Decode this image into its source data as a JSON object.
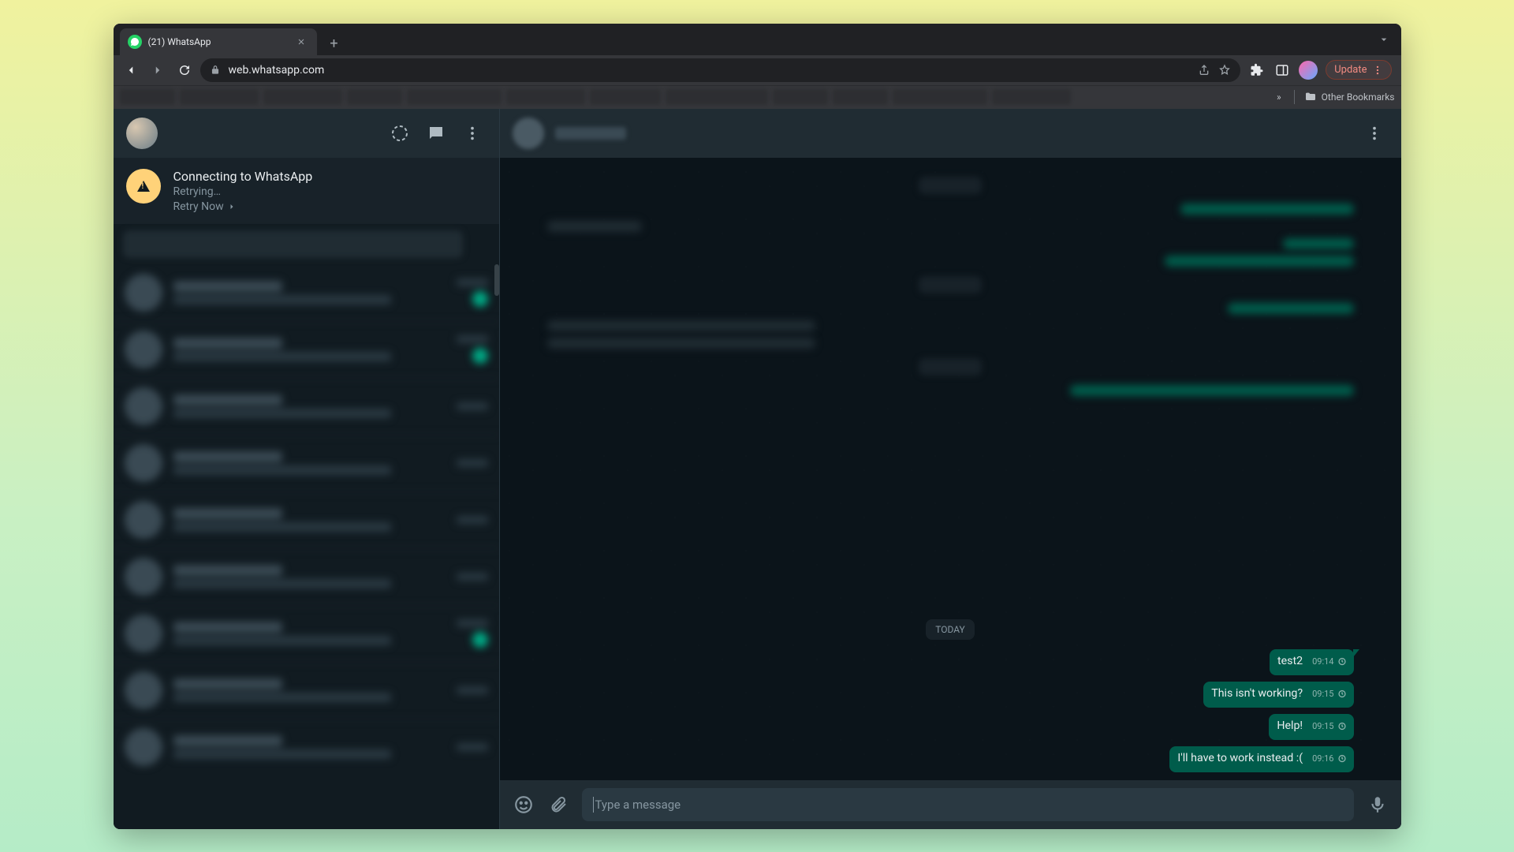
{
  "browser": {
    "tab_title": "(21) WhatsApp",
    "url": "web.whatsapp.com",
    "update_label": "Update",
    "other_bookmarks_label": "Other Bookmarks",
    "overflow_label": "»"
  },
  "sidebar": {
    "connection": {
      "title": "Connecting to WhatsApp",
      "status": "Retrying…",
      "retry_label": "Retry Now"
    }
  },
  "chat": {
    "day_label": "TODAY",
    "messages": [
      {
        "text": "test2",
        "time": "09:14"
      },
      {
        "text": "This isn't working?",
        "time": "09:15"
      },
      {
        "text": "Help!",
        "time": "09:15"
      },
      {
        "text": "I'll have to work instead :(",
        "time": "09:16"
      }
    ],
    "composer_placeholder": "Type a message"
  }
}
